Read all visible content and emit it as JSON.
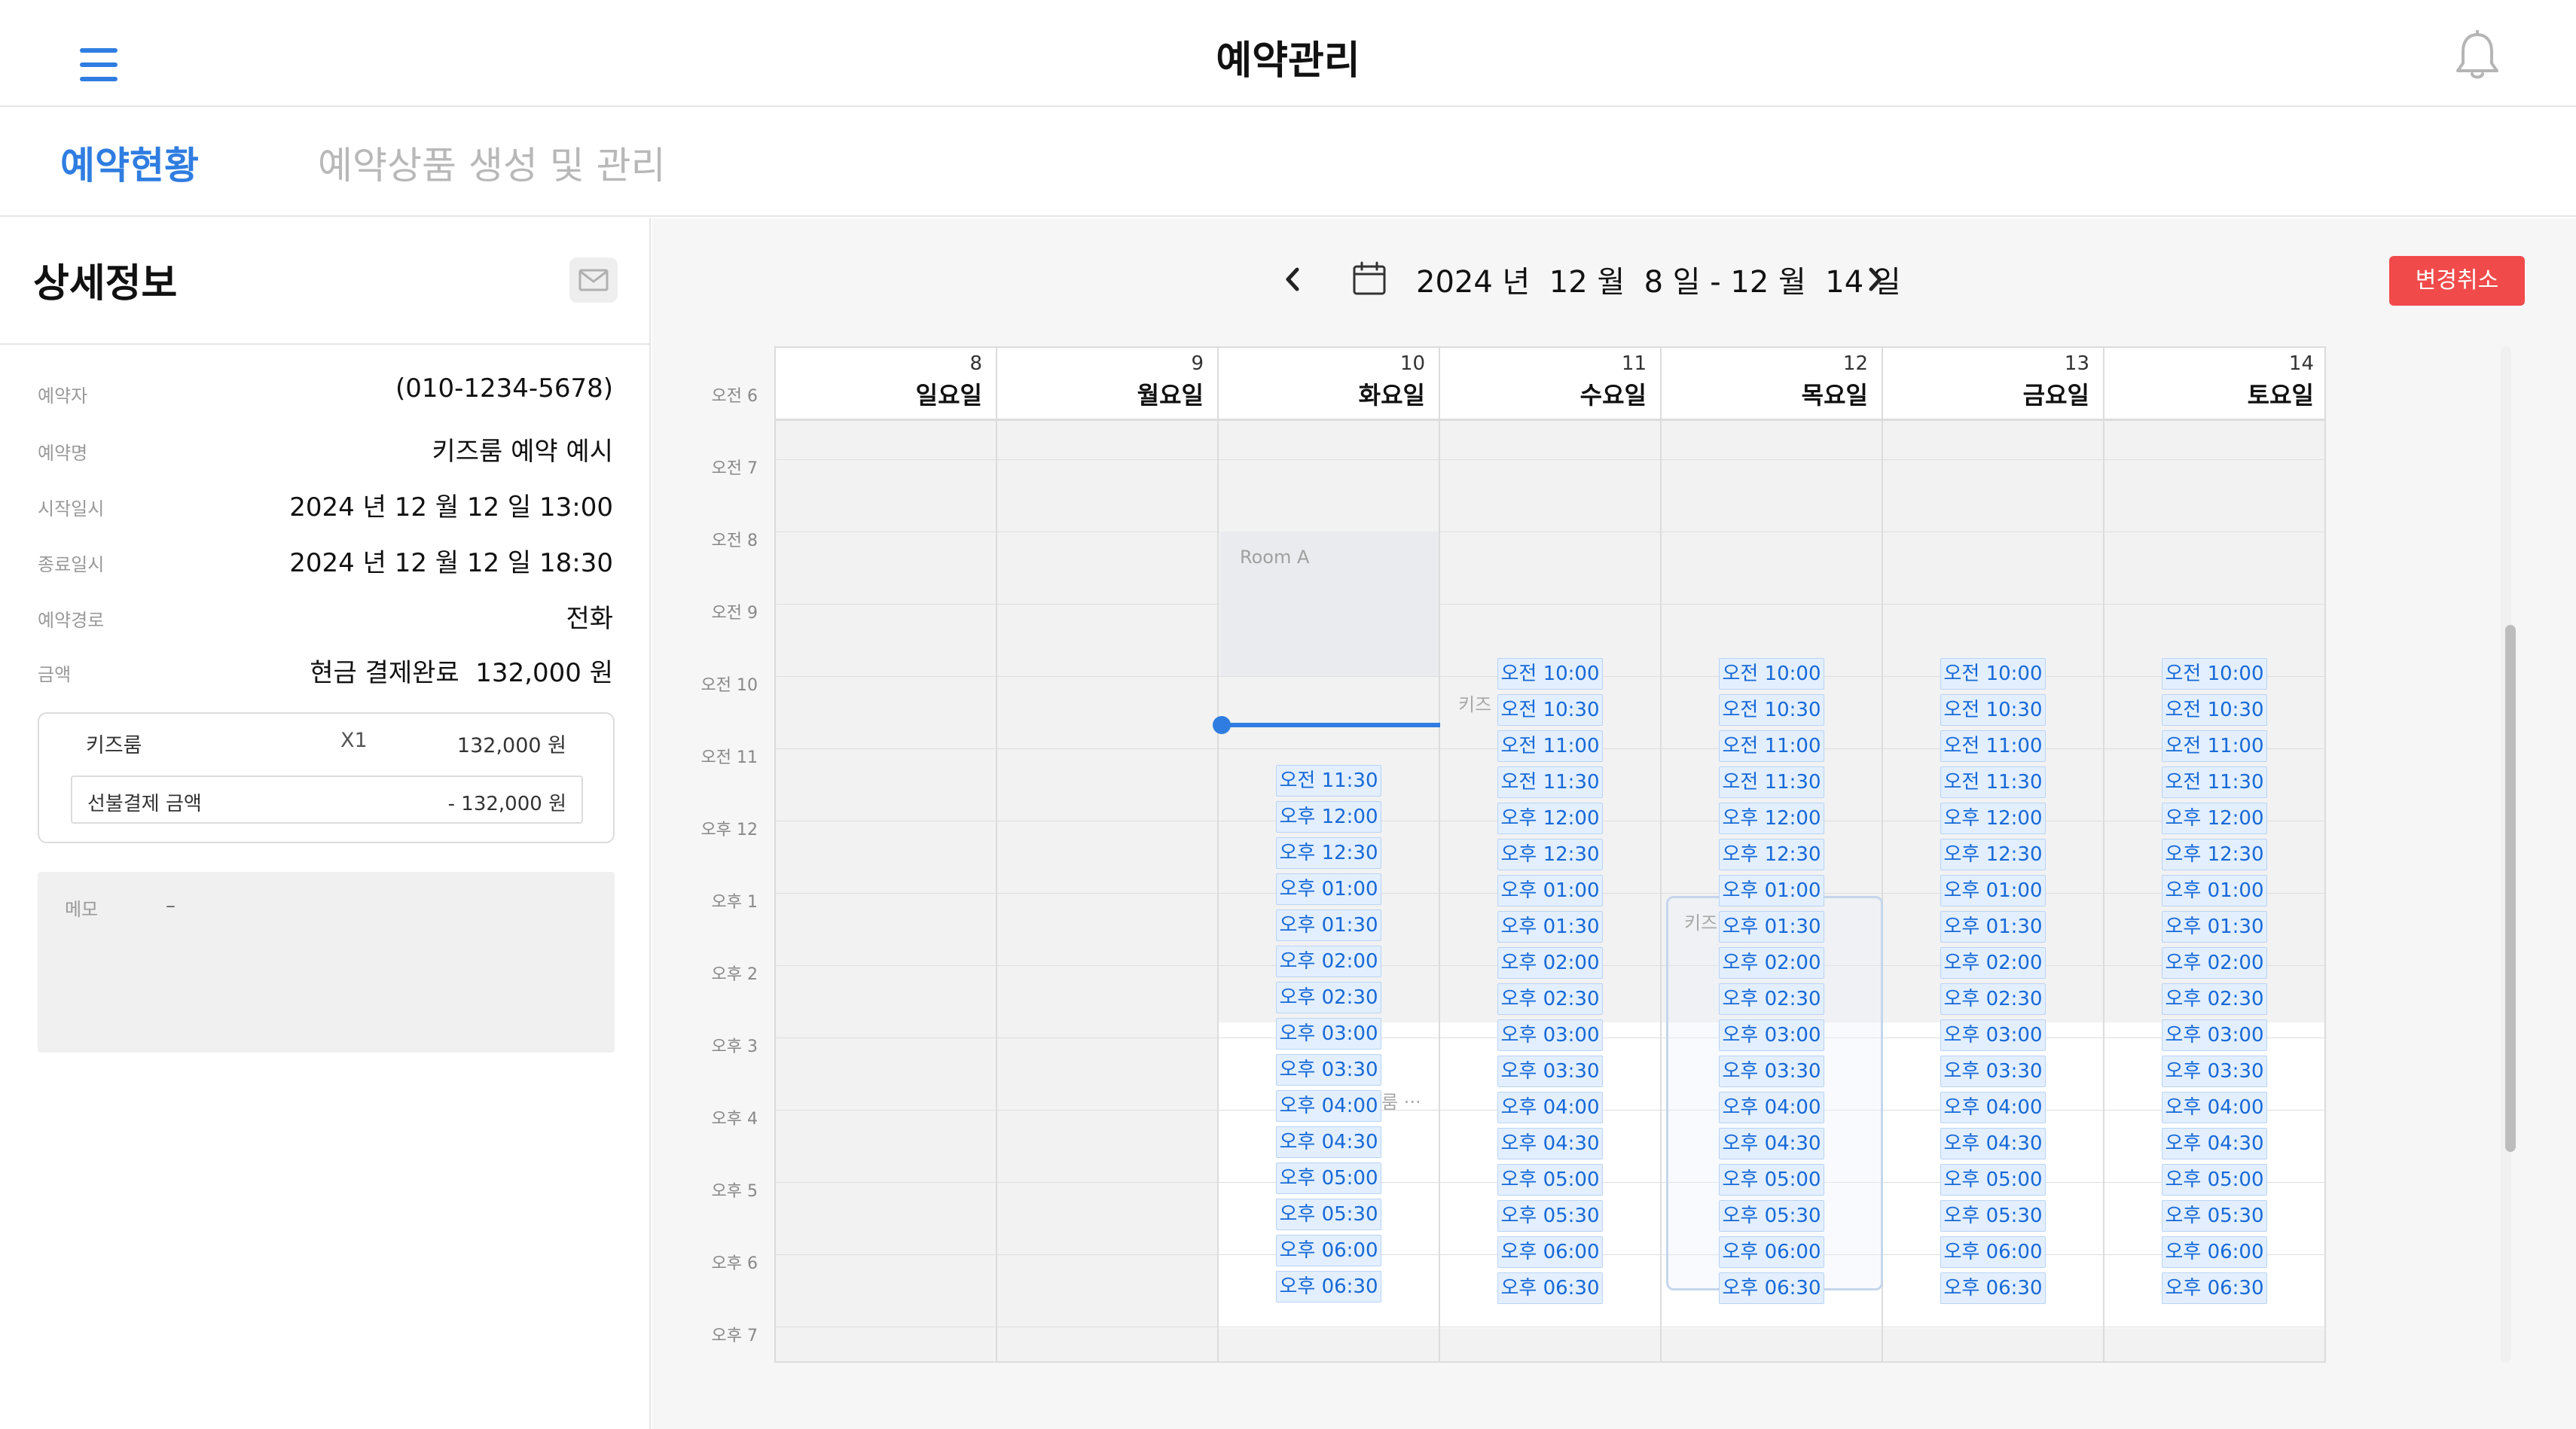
{
  "header": {
    "title": "예약관리"
  },
  "tabs": [
    {
      "label": "예약현황"
    },
    {
      "label": "예약상품 생성 및 관리"
    }
  ],
  "detail": {
    "title": "상세정보",
    "fields": [
      {
        "label": "예약자",
        "value": "(010-1234-5678)"
      },
      {
        "label": "예약명",
        "value": "키즈룸 예약 예시"
      },
      {
        "label": "시작일시",
        "value": "2024 년 12 월 12 일 13:00"
      },
      {
        "label": "종료일시",
        "value": "2024 년 12 월 12 일 18:30"
      },
      {
        "label": "예약경로",
        "value": "전화"
      },
      {
        "label": "금액",
        "value": "현금 결제완료  132,000 원"
      }
    ],
    "item": {
      "name": "키즈룸",
      "qty": "X1",
      "price": "132,000 원"
    },
    "prepaid": {
      "label": "선불결제 금액",
      "value": "- 132,000 원"
    },
    "memo": {
      "label": "메모",
      "value": "–"
    }
  },
  "calendar": {
    "range": "2024 년  12 월  8 일 - 12 월  14 일",
    "cancel_label": "변경취소",
    "time_labels": [
      "오전 6",
      "오전 7",
      "오전 8",
      "오전 9",
      "오전 10",
      "오전 11",
      "오후 12",
      "오후 1",
      "오후 2",
      "오후 3",
      "오후 4",
      "오후 5",
      "오후 6",
      "오후 7"
    ],
    "days": [
      {
        "num": "8",
        "name": "일요일"
      },
      {
        "num": "9",
        "name": "월요일"
      },
      {
        "num": "10",
        "name": "화요일"
      },
      {
        "num": "11",
        "name": "수요일"
      },
      {
        "num": "12",
        "name": "목요일"
      },
      {
        "num": "13",
        "name": "금요일"
      },
      {
        "num": "14",
        "name": "토요일"
      }
    ],
    "room_label": "Room A",
    "res_label_1": "키즈",
    "res_label_2": "키즈",
    "res_label_3": "룸 ···",
    "slots_tue": [
      "오전 11:30",
      "오후 12:00",
      "오후 12:30",
      "오후 01:00",
      "오후 01:30",
      "오후 02:00",
      "오후 02:30",
      "오후 03:00",
      "오후 03:30",
      "오후 04:00",
      "오후 04:30",
      "오후 05:00",
      "오후 05:30",
      "오후 06:00",
      "오후 06:30"
    ],
    "slots_full": [
      "오전 10:00",
      "오전 10:30",
      "오전 11:00",
      "오전 11:30",
      "오후 12:00",
      "오후 12:30",
      "오후 01:00",
      "오후 01:30",
      "오후 02:00",
      "오후 02:30",
      "오후 03:00",
      "오후 03:30",
      "오후 04:00",
      "오후 04:30",
      "오후 05:00",
      "오후 05:30",
      "오후 06:00",
      "오후 06:30"
    ]
  },
  "colors": {
    "accent": "#2f7de1",
    "danger": "#f14a4a",
    "slot_bg": "#e3efff",
    "slot_text": "#1669d6"
  },
  "icons": {
    "menu": "hamburger-menu-icon",
    "bell": "bell-icon",
    "mail": "mail-icon",
    "calendar": "calendar-icon",
    "prev": "chevron-left-icon",
    "next": "chevron-right-icon"
  }
}
